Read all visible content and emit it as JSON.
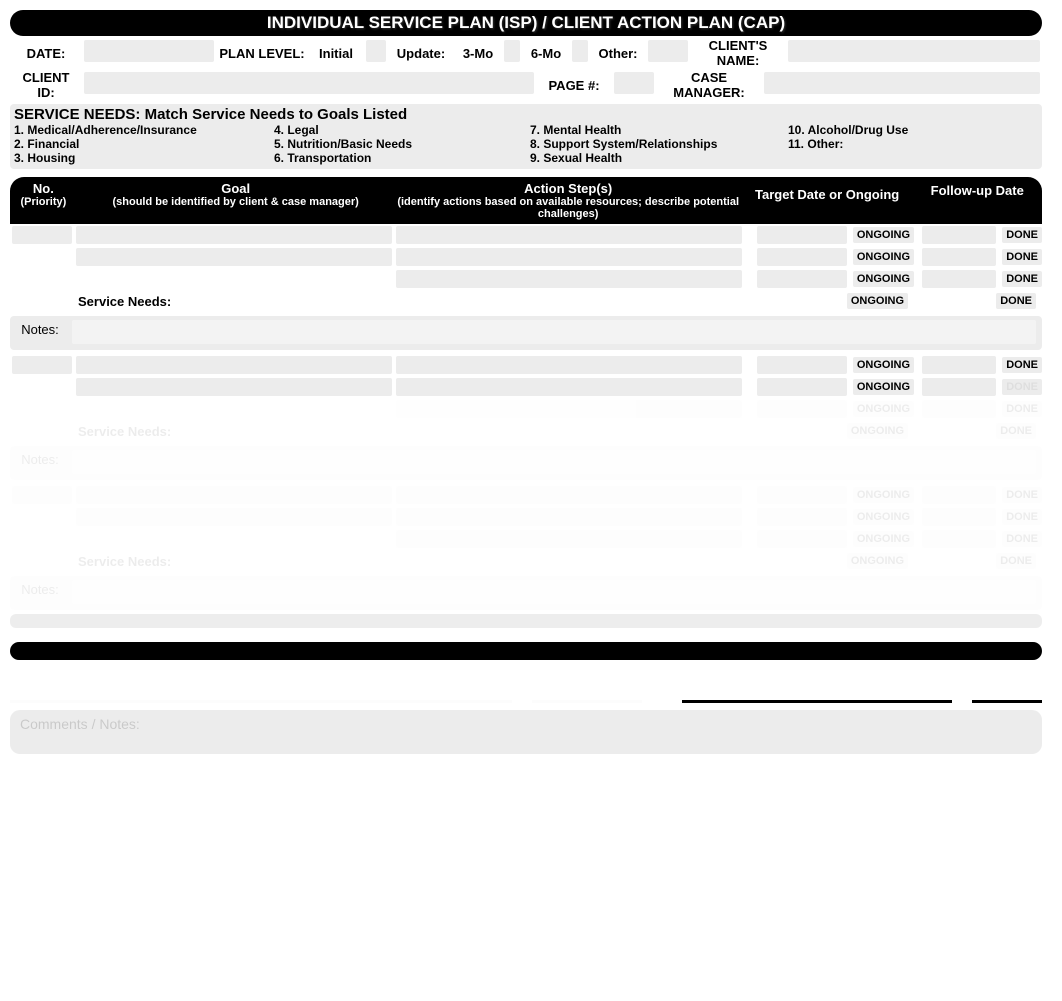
{
  "title": "INDIVIDUAL SERVICE PLAN (ISP) / CLIENT ACTION PLAN (CAP)",
  "row1": {
    "date_label": "DATE:",
    "plan_level_label": "PLAN LEVEL:",
    "initial_label": "Initial",
    "update_label": "Update:",
    "mo3_label": "3-Mo",
    "mo6_label": "6-Mo",
    "other_label": "Other:",
    "client_name_label": "CLIENT'S NAME:"
  },
  "row2": {
    "client_id_label": "CLIENT ID:",
    "page_label": "PAGE #:",
    "case_mgr_label": "CASE MANAGER:"
  },
  "service_needs": {
    "header": "SERVICE NEEDS: Match Service Needs to Goals Listed",
    "col1": [
      "1. Medical/Adherence/Insurance",
      "2. Financial",
      "3. Housing"
    ],
    "col2": [
      "4. Legal",
      "5. Nutrition/Basic Needs",
      "6. Transportation"
    ],
    "col3": [
      "7. Mental Health",
      "8. Support System/Relationships",
      "9. Sexual Health"
    ],
    "col4": [
      "10. Alcohol/Drug Use",
      "11. Other:"
    ]
  },
  "goals_header": {
    "no": "No.",
    "no_sub": "(Priority)",
    "goal": "Goal",
    "goal_sub": "(should be identified by client & case manager)",
    "action": "Action Step(s)",
    "action_sub": "(identify actions based on available resources; describe potential challenges)",
    "target": "Target Date or Ongoing",
    "followup": "Follow-up Date"
  },
  "words": {
    "ongoing": "ONGOING",
    "done": "DONE",
    "service_needs_label": "Service Needs:",
    "notes": "Notes:"
  },
  "comments_label": "Comments / Notes:"
}
